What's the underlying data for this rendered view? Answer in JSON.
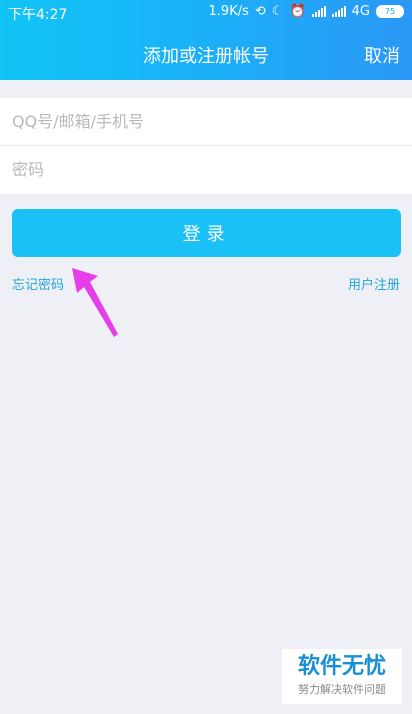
{
  "status_bar": {
    "time": "下午4:27",
    "speed": "1.9K/s",
    "network": "4G",
    "battery": "75"
  },
  "nav": {
    "title": "添加或注册帐号",
    "cancel_label": "取消"
  },
  "form": {
    "account_placeholder": "QQ号/邮箱/手机号",
    "password_placeholder": "密码"
  },
  "login_button_label": "登录",
  "links": {
    "forgot_password": "忘记密码",
    "register": "用户注册"
  },
  "watermark": {
    "title": "软件无忧",
    "subtitle": "努力解决软件问题"
  },
  "colors": {
    "header_gradient_start": "#12c5f6",
    "header_gradient_end": "#2a98f6",
    "login_button": "#19c1f7",
    "link": "#23a4dd",
    "arrow": "#e63ee9",
    "background": "#eff0f5"
  }
}
